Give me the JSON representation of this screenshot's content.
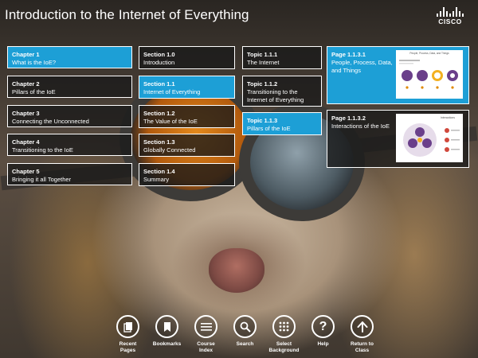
{
  "header": {
    "title": "Introduction to the Internet of Everything",
    "logo_text": "CISCO"
  },
  "chapters": [
    {
      "code": "Chapter 1",
      "label": "What is the IoE?",
      "active": true
    },
    {
      "code": "Chapter 2",
      "label": "Pillars of the IoE",
      "active": false
    },
    {
      "code": "Chapter 3",
      "label": "Connecting the Unconnected",
      "active": false
    },
    {
      "code": "Chapter 4",
      "label": "Transitioning to the IoE",
      "active": false
    },
    {
      "code": "Chapter 5",
      "label": "Bringing it all Together",
      "active": false
    }
  ],
  "sections": [
    {
      "code": "Section 1.0",
      "label": "Introduction",
      "active": false
    },
    {
      "code": "Section 1.1",
      "label": "Internet of Everything",
      "active": true
    },
    {
      "code": "Section 1.2",
      "label": "The Value of the IoE",
      "active": false
    },
    {
      "code": "Section 1.3",
      "label": "Globally Connected",
      "active": false
    },
    {
      "code": "Section 1.4",
      "label": "Summary",
      "active": false
    }
  ],
  "topics": [
    {
      "code": "Topic 1.1.1",
      "label": "The Internet",
      "active": false
    },
    {
      "code": "Topic 1.1.2",
      "label": "Transitioning to the Internet of Everything",
      "active": false
    },
    {
      "code": "Topic 1.1.3",
      "label": "Pillars of the IoE",
      "active": true
    }
  ],
  "pages": [
    {
      "code": "Page 1.1.3.1",
      "label": "People, Process, Data, and Things",
      "active": true,
      "thumb_title": "People, Process, Data, and Things"
    },
    {
      "code": "Page 1.1.3.2",
      "label": "Interactions of the IoE",
      "active": false,
      "thumb_title": "Interactions"
    }
  ],
  "toolbar": [
    {
      "icon": "recent-pages-icon",
      "label": "Recent\nPages"
    },
    {
      "icon": "bookmark-icon",
      "label": "Bookmarks"
    },
    {
      "icon": "course-index-icon",
      "label": "Course\nIndex"
    },
    {
      "icon": "search-icon",
      "label": "Search"
    },
    {
      "icon": "grid-icon",
      "label": "Select\nBackground"
    },
    {
      "icon": "help-icon",
      "label": "Help"
    },
    {
      "icon": "arrow-up-icon",
      "label": "Return to\nClass"
    }
  ],
  "colors": {
    "accent": "#1d9fd6",
    "tile_bg": "#191919"
  }
}
